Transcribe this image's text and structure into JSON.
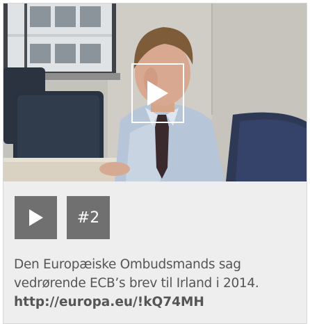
{
  "video": {
    "overlay_icon": "play-icon",
    "thumbnail_subject": "play-triangle"
  },
  "controls": {
    "play_icon": "play-icon",
    "episode_label": "#2"
  },
  "caption": {
    "line1": "Den Europæiske Ombudsmands sag",
    "line2": "vedrørende ECB’s brev til Irland i 2014.",
    "link": "http://europa.eu/!kQ74MH"
  },
  "colors": {
    "card_background": "#eeeeee",
    "button_background": "#707070",
    "text": "#555555",
    "icon": "#ffffff"
  }
}
